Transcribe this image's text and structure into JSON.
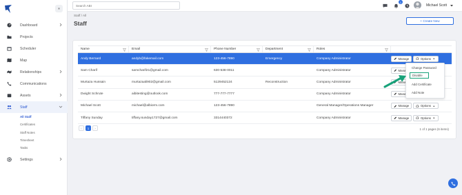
{
  "topbar": {
    "search_placeholder": "Search ABI",
    "notification_count": "1",
    "user_name": "Michael Scott"
  },
  "sidebar": {
    "items": [
      {
        "label": "Dashboard",
        "icon": "dashboard-icon",
        "has_children": true
      },
      {
        "label": "Projects",
        "icon": "folder-icon",
        "has_children": false
      },
      {
        "label": "Scheduler",
        "icon": "calendar-icon",
        "has_children": false
      },
      {
        "label": "Map",
        "icon": "map-icon",
        "has_children": false
      },
      {
        "label": "Relationships",
        "icon": "handshake-icon",
        "has_children": true
      },
      {
        "label": "Communications",
        "icon": "phone-icon",
        "has_children": false
      },
      {
        "label": "Assets",
        "icon": "assets-icon",
        "has_children": true
      },
      {
        "label": "Staff",
        "icon": "staff-icon",
        "has_children": true,
        "active": true
      },
      {
        "label": "Settings",
        "icon": "gear-icon",
        "has_children": true
      }
    ],
    "staff_sub": [
      "All Staff",
      "Certificates",
      "Staff Notes",
      "Timesheet",
      "Tasks"
    ]
  },
  "page": {
    "breadcrumb": "Staff / All",
    "title": "Staff",
    "create_button": "+ Create New"
  },
  "table": {
    "headers": [
      "Name",
      "Email",
      "Phone Number",
      "Department",
      "Roles"
    ],
    "manage_label": "Manage",
    "options_label": "Options",
    "rows": [
      {
        "name": "Andy Bernard",
        "email": "andyb@fakemail.com",
        "phone": "123-456-7890",
        "department": "Emergency",
        "roles": "Company Administrator",
        "selected": true
      },
      {
        "name": "Sam Charif",
        "email": "samcharif21@gmail.com",
        "phone": "630-538-0011",
        "department": "",
        "roles": "Company Administrator"
      },
      {
        "name": "Murtaza Hussain",
        "email": "murtazaali902@gmail.com",
        "phone": "5129452124",
        "department": "Reconstruction",
        "roles": "Company Administrator"
      },
      {
        "name": "Dwight Schrute",
        "email": "aibitesting@outlook.com",
        "phone": "777-777-7777",
        "department": "",
        "roles": "Company Administrator"
      },
      {
        "name": "Michael Scott",
        "email": "michael@albiorm.com",
        "phone": "123-456-7890",
        "department": "",
        "roles": "General Manager/Operations Manager"
      },
      {
        "name": "Tiffany Sunday",
        "email": "tiffany.sunday1727@gmail.com",
        "phone": "3314440372",
        "department": "",
        "roles": "Company Administrator"
      }
    ],
    "pager_page": "1",
    "pager_prev": "‹",
    "pager_next": "›",
    "pager_info": "1 of 1 pages (6 items)"
  },
  "dropdown": {
    "items": [
      "Change Password",
      "Disable",
      "Add Certificate",
      "Add Note"
    ]
  },
  "colors": {
    "accent": "#2f6fe0",
    "annotation": "#18a27a"
  }
}
